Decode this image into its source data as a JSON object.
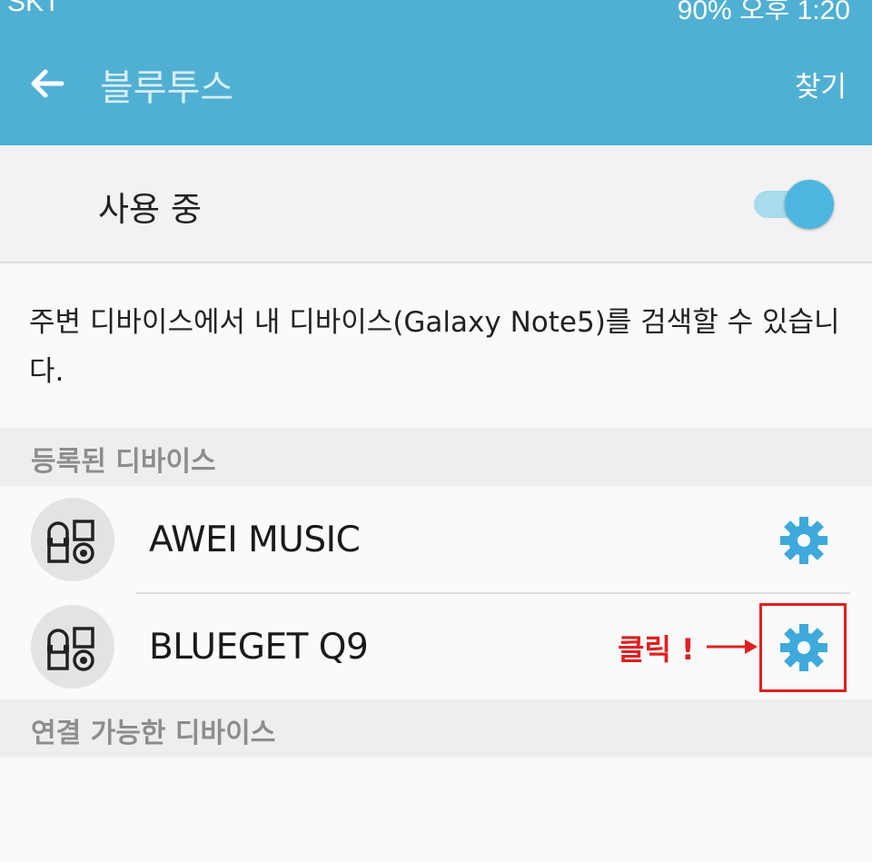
{
  "status_bar": {
    "carrier": "SKT",
    "battery": "90%",
    "time": "오후 1:20"
  },
  "app_bar": {
    "title": "블루투스",
    "action_label": "찾기",
    "color": "#50b0d4"
  },
  "toggle": {
    "label": "사용 중",
    "state": "on",
    "accent": "#4db6e0"
  },
  "description": "주변 디바이스에서 내 디바이스(Galaxy Note5)를 검색할 수 있습니다.",
  "paired_section": {
    "header": "등록된 디바이스",
    "devices": [
      {
        "name": "AWEI MUSIC",
        "icon": "headphone-device-icon",
        "settings_icon": "gear-icon"
      },
      {
        "name": "BLUEGET Q9",
        "icon": "headphone-device-icon",
        "settings_icon": "gear-icon"
      }
    ]
  },
  "available_section": {
    "header": "연결 가능한 디바이스"
  },
  "annotation": {
    "text": "클릭 !",
    "color": "#e02020"
  }
}
